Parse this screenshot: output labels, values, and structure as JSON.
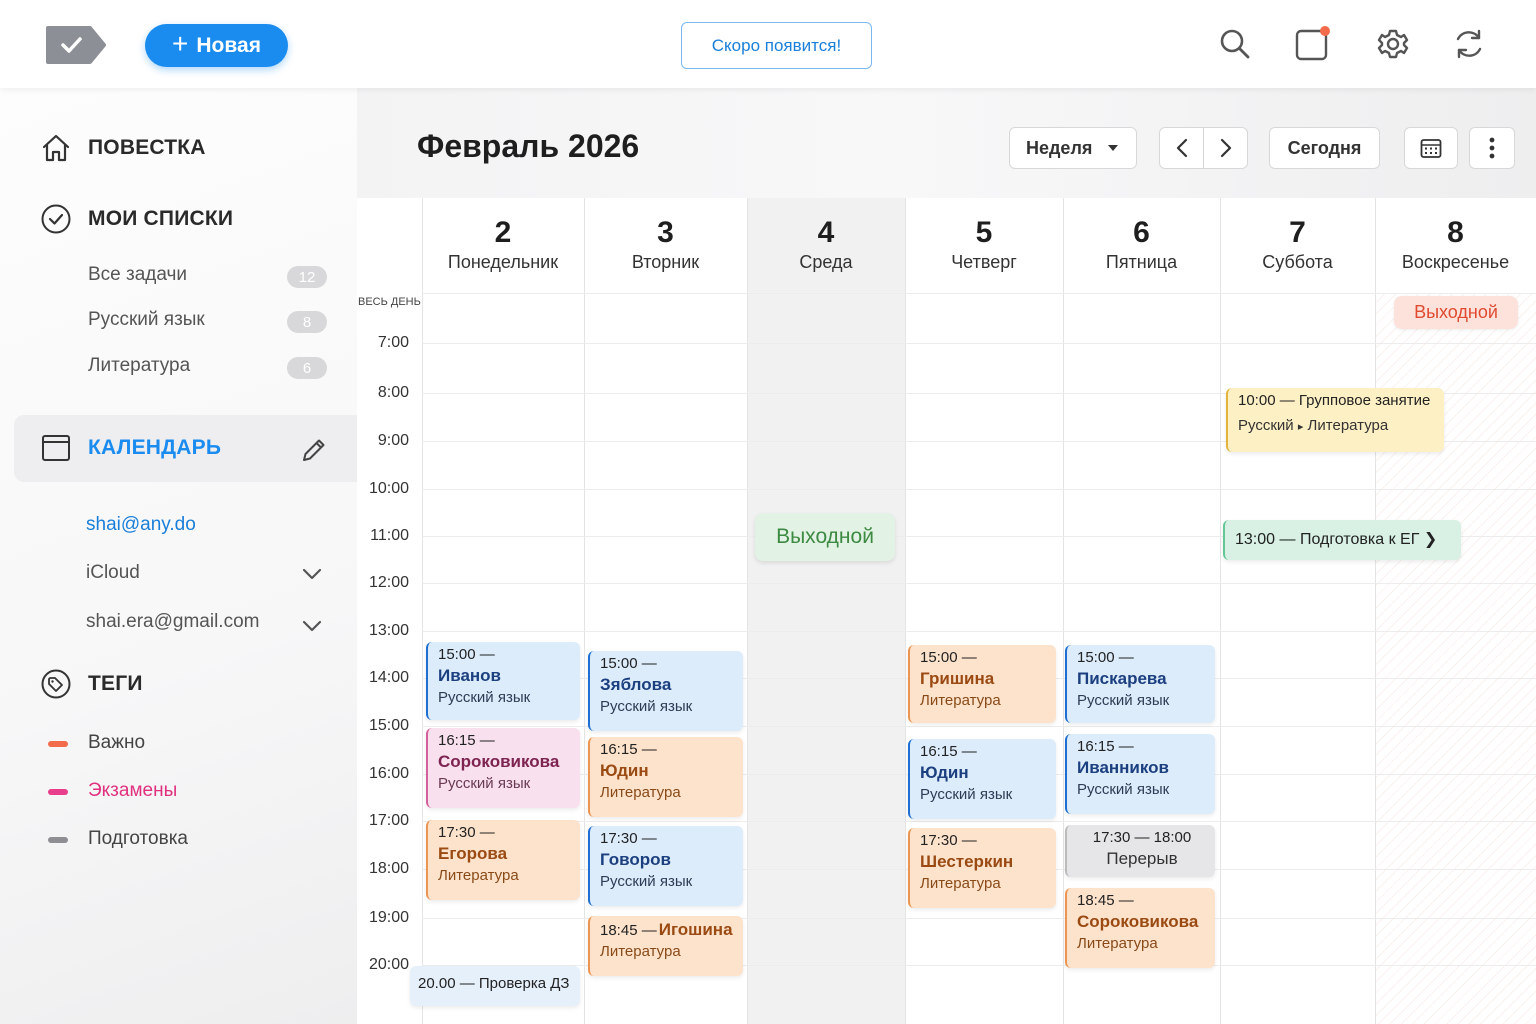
{
  "header": {
    "new_label": "Новая",
    "soon_label": "Скоро появится!"
  },
  "sidebar": {
    "agenda": "ПОВЕСТКА",
    "my_lists": "МОИ СПИСКИ",
    "lists": [
      {
        "label": "Все задачи",
        "count": "12"
      },
      {
        "label": "Русский язык",
        "count": "8"
      },
      {
        "label": "Литература",
        "count": "6"
      }
    ],
    "calendar": "КАЛЕНДАРЬ",
    "accounts": [
      "shai@any.do",
      "iCloud",
      "shai.era@gmail.com"
    ],
    "tags_title": "ТЕГИ",
    "tags": [
      {
        "label": "Важно",
        "color": "#f26b4a"
      },
      {
        "label": "Экзамены",
        "color": "#e83e8c"
      },
      {
        "label": "Подготовка",
        "color": "#8e8e93"
      }
    ]
  },
  "calendar": {
    "title": "Февраль 2026",
    "view": "Неделя",
    "today": "Сегодня",
    "all_day": "ВЕСЬ ДЕНЬ",
    "days": [
      {
        "num": "2",
        "name": "Понедельник"
      },
      {
        "num": "3",
        "name": "Вторник"
      },
      {
        "num": "4",
        "name": "Среда"
      },
      {
        "num": "5",
        "name": "Четверг"
      },
      {
        "num": "6",
        "name": "Пятница"
      },
      {
        "num": "7",
        "name": "Суббота"
      },
      {
        "num": "8",
        "name": "Воскресенье"
      }
    ],
    "hours": [
      "7:00",
      "8:00",
      "9:00",
      "10:00",
      "11:00",
      "12:00",
      "13:00",
      "14:00",
      "15:00",
      "16:00",
      "17:00",
      "18:00",
      "19:00",
      "20:00"
    ],
    "sunday_badge": "Выходной",
    "wednesday_badge": "Выходной",
    "events": {
      "mon1": {
        "time": "15:00 —",
        "name": "Иванов",
        "subject": "Русский язык"
      },
      "mon2": {
        "time": "16:15 —",
        "name": "Сороковикова",
        "subject": "Русский язык"
      },
      "mon3": {
        "time": "17:30 —",
        "name": "Егорова",
        "subject": "Литература"
      },
      "mon4": {
        "text": "20.00 — Проверка ДЗ"
      },
      "tue1": {
        "time": "15:00 —",
        "name": "Зяблова",
        "subject": "Русский язык"
      },
      "tue2": {
        "time": "16:15 —",
        "name": "Юдин",
        "subject": "Литература"
      },
      "tue3": {
        "time": "17:30 —",
        "name": "Говоров",
        "subject": "Русский язык"
      },
      "tue4": {
        "time": "18:45 —",
        "name": "Игошина",
        "subject": "Литература"
      },
      "thu1": {
        "time": "15:00 —",
        "name": "Гришина",
        "subject": "Литература"
      },
      "thu2": {
        "time": "16:15 —",
        "name": "Юдин",
        "subject": "Русский язык"
      },
      "thu3": {
        "time": "17:30 —",
        "name": "Шестеркин",
        "subject": "Литература"
      },
      "fri1": {
        "time": "15:00 —",
        "name": "Пискарева",
        "subject": "Русский язык"
      },
      "fri2": {
        "time": "16:15 —",
        "name": "Иванников",
        "subject": "Русский язык"
      },
      "fri3": {
        "time": "17:30 — 18:00",
        "name": "Перерыв"
      },
      "fri4": {
        "time": "18:45 —",
        "name": "Сороковикова",
        "subject": "Литература"
      },
      "sat1": {
        "time": "10:00 —",
        "title": "Групповое занятие",
        "path_a": "Русский",
        "path_b": "Литература"
      },
      "sat2": {
        "time": "13:00 —",
        "title": "Подготовка к ЕГ"
      }
    }
  }
}
